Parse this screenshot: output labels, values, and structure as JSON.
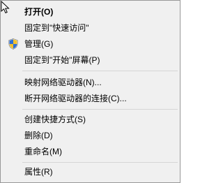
{
  "context_menu": {
    "items": [
      {
        "label": "打开(O)"
      },
      {
        "label": "固定到\"快速访问\""
      },
      {
        "label": "管理(G)",
        "icon": "uac-shield-icon"
      },
      {
        "label": "固定到\"开始\"屏幕(P)"
      },
      {
        "label": "映射网络驱动器(N)..."
      },
      {
        "label": "断开网络驱动器的连接(C)..."
      },
      {
        "label": "创建快捷方式(S)"
      },
      {
        "label": "删除(D)"
      },
      {
        "label": "重命名(M)"
      },
      {
        "label": "属性(R)"
      }
    ],
    "colors": {
      "background": "#f0f0f0",
      "border": "#979797",
      "separator": "#d6d6d6",
      "text": "#000000"
    }
  }
}
